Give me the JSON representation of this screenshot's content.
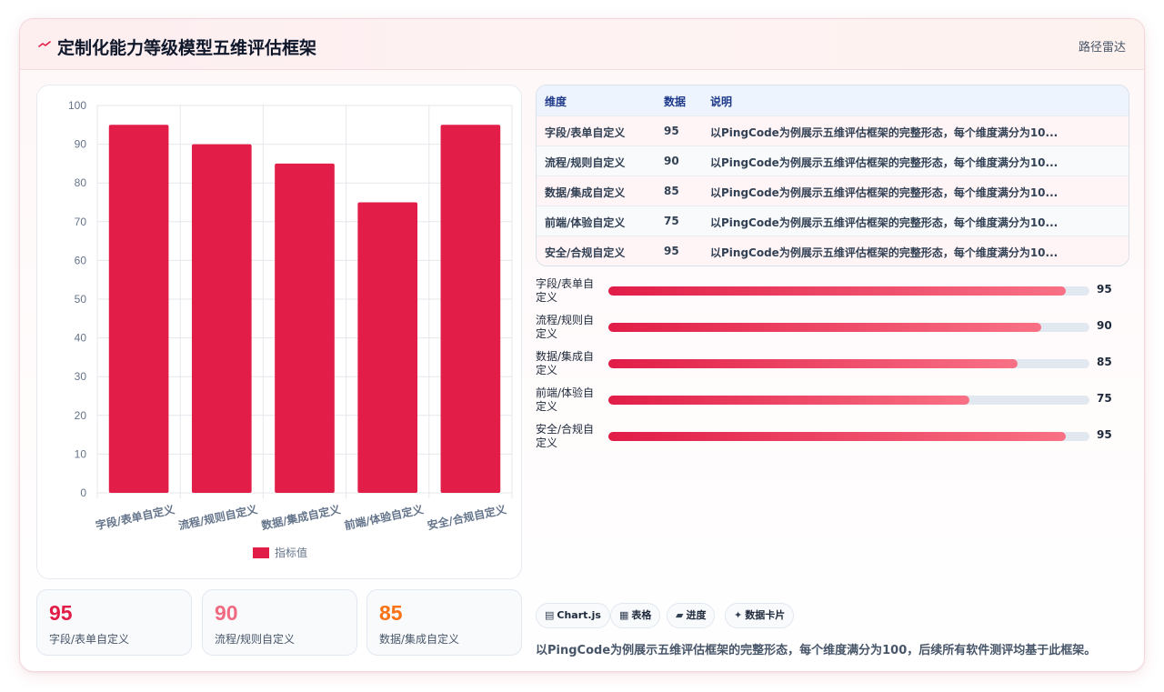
{
  "header": {
    "icon": "trend-icon",
    "title": "定制化能力等级模型五维评估框架",
    "route_label": "路径雷达"
  },
  "chart_data": {
    "type": "bar",
    "categories": [
      "字段/表单自定义",
      "流程/规则自定义",
      "数据/集成自定义",
      "前端/体验自定义",
      "安全/合规自定义"
    ],
    "series": [
      {
        "name": "指标值",
        "values": [
          95,
          90,
          85,
          75,
          95
        ],
        "color": "#e11d48"
      }
    ],
    "ylim": [
      0,
      100
    ],
    "yticks": [
      0,
      10,
      20,
      30,
      40,
      50,
      60,
      70,
      80,
      90,
      100
    ],
    "grid": true,
    "legend": "bottom"
  },
  "table": {
    "headers": [
      "维度",
      "数据",
      "说明"
    ],
    "rows": [
      [
        "字段/表单自定义",
        "95",
        "以PingCode为例展示五维评估框架的完整形态，每个维度满分为10..."
      ],
      [
        "流程/规则自定义",
        "90",
        "以PingCode为例展示五维评估框架的完整形态，每个维度满分为10..."
      ],
      [
        "数据/集成自定义",
        "85",
        "以PingCode为例展示五维评估框架的完整形态，每个维度满分为10..."
      ],
      [
        "前端/体验自定义",
        "75",
        "以PingCode为例展示五维评估框架的完整形态，每个维度满分为10..."
      ],
      [
        "安全/合规自定义",
        "95",
        "以PingCode为例展示五维评估框架的完整形态，每个维度满分为10..."
      ]
    ]
  },
  "progress": [
    {
      "label": "字段/表单自定义",
      "value": 95
    },
    {
      "label": "流程/规则自定义",
      "value": 90
    },
    {
      "label": "数据/集成自定义",
      "value": 85
    },
    {
      "label": "前端/体验自定义",
      "value": 75
    },
    {
      "label": "安全/合规自定义",
      "value": 95
    }
  ],
  "stats": [
    {
      "value": "95",
      "label": "字段/表单自定义",
      "color": "#e11d48"
    },
    {
      "value": "90",
      "label": "流程/规则自定义",
      "color": "#f06b82"
    },
    {
      "value": "85",
      "label": "数据/集成自定义",
      "color": "#f97316"
    }
  ],
  "chips": [
    {
      "icon": "grid-icon",
      "glyph": "▤",
      "label": "Chart.js"
    },
    {
      "icon": "table-icon",
      "glyph": "▦",
      "label": "表格"
    },
    {
      "icon": "progress-icon",
      "glyph": "▰",
      "label": "进度"
    },
    {
      "icon": "sparkle-icon",
      "glyph": "✦",
      "label": "数据卡片"
    }
  ],
  "description": "以PingCode为例展示五维评估框架的完整形态，每个维度满分为100，后续所有软件测评均基于此框架。"
}
